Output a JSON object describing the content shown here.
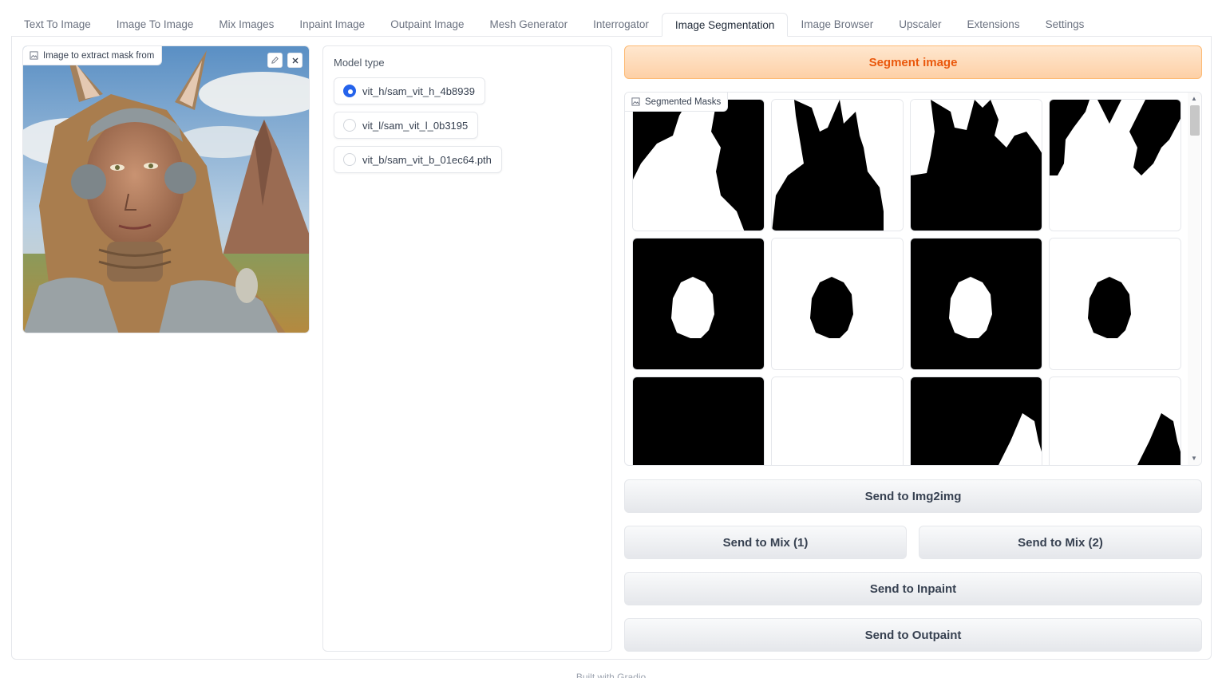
{
  "tabs": [
    {
      "label": "Text To Image"
    },
    {
      "label": "Image To Image"
    },
    {
      "label": "Mix Images"
    },
    {
      "label": "Inpaint Image"
    },
    {
      "label": "Outpaint Image"
    },
    {
      "label": "Mesh Generator"
    },
    {
      "label": "Interrogator"
    },
    {
      "label": "Image Segmentation"
    },
    {
      "label": "Image Browser"
    },
    {
      "label": "Upscaler"
    },
    {
      "label": "Extensions"
    },
    {
      "label": "Settings"
    }
  ],
  "active_tab": "Image Segmentation",
  "input_image": {
    "label": "Image to extract mask from",
    "icons": [
      "edit-icon",
      "close-icon"
    ]
  },
  "model_type": {
    "title": "Model type",
    "options": [
      {
        "label": "vit_h/sam_vit_h_4b8939",
        "checked": true
      },
      {
        "label": "vit_l/sam_vit_l_0b3195",
        "checked": false
      },
      {
        "label": "vit_b/sam_vit_b_01ec64.pth",
        "checked": false
      }
    ]
  },
  "segment_button": "Segment image",
  "gallery": {
    "label": "Segmented Masks"
  },
  "buttons": {
    "send_img2img": "Send to Img2img",
    "send_mix1": "Send to Mix (1)",
    "send_mix2": "Send to Mix (2)",
    "send_inpaint": "Send to Inpaint",
    "send_outpaint": "Send to Outpaint"
  },
  "colors": {
    "accent": "#ea580c",
    "radio": "#2563eb"
  },
  "footer": "Built with Gradio"
}
